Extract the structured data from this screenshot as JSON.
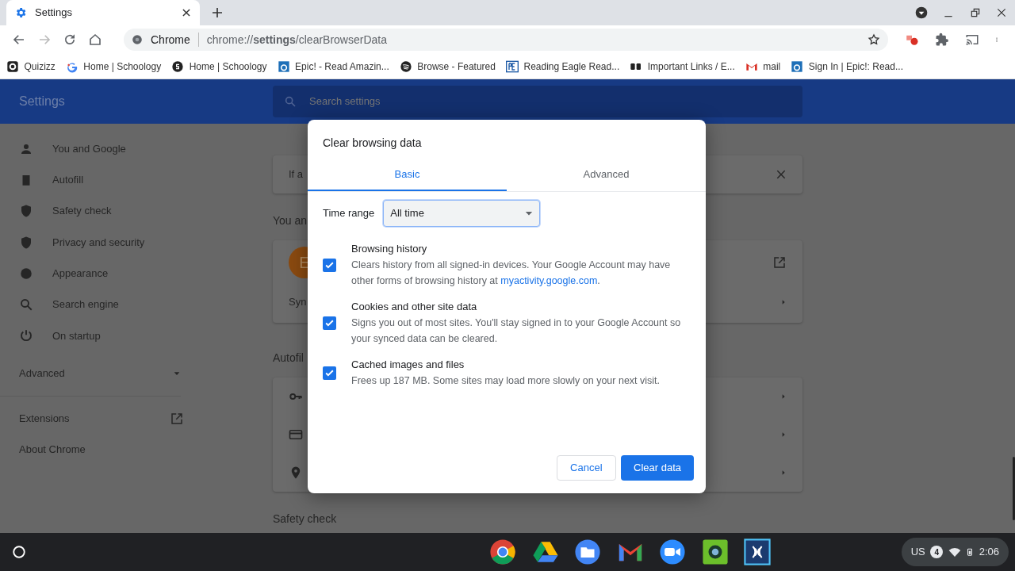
{
  "browser_tabs": [
    {
      "label": "Settings",
      "selected": true
    }
  ],
  "address_bar": {
    "site_label": "Chrome",
    "url": "chrome://**settings**/clearBrowserData"
  },
  "bookmarks": [
    {
      "label": "Quizizz"
    },
    {
      "label": "Home | Schoology"
    },
    {
      "label": "Home | Schoology"
    },
    {
      "label": "Epic! - Read Amazin..."
    },
    {
      "label": "Browse - Featured"
    },
    {
      "label": "Reading Eagle Read..."
    },
    {
      "label": "Important Links / E..."
    },
    {
      "label": "mail"
    },
    {
      "label": "Sign In | Epic!: Read..."
    }
  ],
  "settings": {
    "title": "Settings",
    "search_placeholder": "Search settings",
    "sidebar": {
      "items": [
        {
          "label": "You and Google"
        },
        {
          "label": "Autofill"
        },
        {
          "label": "Safety check"
        },
        {
          "label": "Privacy and security"
        },
        {
          "label": "Appearance"
        },
        {
          "label": "Search engine"
        },
        {
          "label": "On startup"
        }
      ],
      "advanced": {
        "label": "Advanced",
        "expanded": false
      },
      "links": [
        "Extensions",
        "About Chrome"
      ]
    },
    "content": {
      "banner": "If a",
      "section_heading": "You an",
      "avatar": "E",
      "sync_label": "Syn",
      "autofill_heading": "Autofil",
      "next_heading": "Safety check"
    }
  },
  "dialog": {
    "title": "Clear browsing data",
    "tabs": [
      {
        "label": "Basic",
        "selected": true
      },
      {
        "label": "Advanced",
        "selected": false
      }
    ],
    "time_range": {
      "label": "Time range",
      "value": "All time"
    },
    "options": [
      {
        "title": "Browsing history",
        "description": "Clears history from all signed-in devices. Your Google Account may have other forms of browsing history at",
        "link": "myactivity.google.com",
        "after_link": ".",
        "checked": true
      },
      {
        "title": "Cookies and other site data",
        "description": "Signs you out of most sites. You'll stay signed in to your Google Account so your synced data can be cleared.",
        "checked": true
      },
      {
        "title": "Cached images and files",
        "description": "Frees up 187 MB. Some sites may load more slowly on your next visit.",
        "checked": true
      }
    ],
    "buttons": {
      "cancel": "Cancel",
      "confirm": "Clear data"
    }
  },
  "taskbar": {
    "tray": {
      "keyboard": "US",
      "notifications": "4",
      "time": "2:06"
    }
  }
}
